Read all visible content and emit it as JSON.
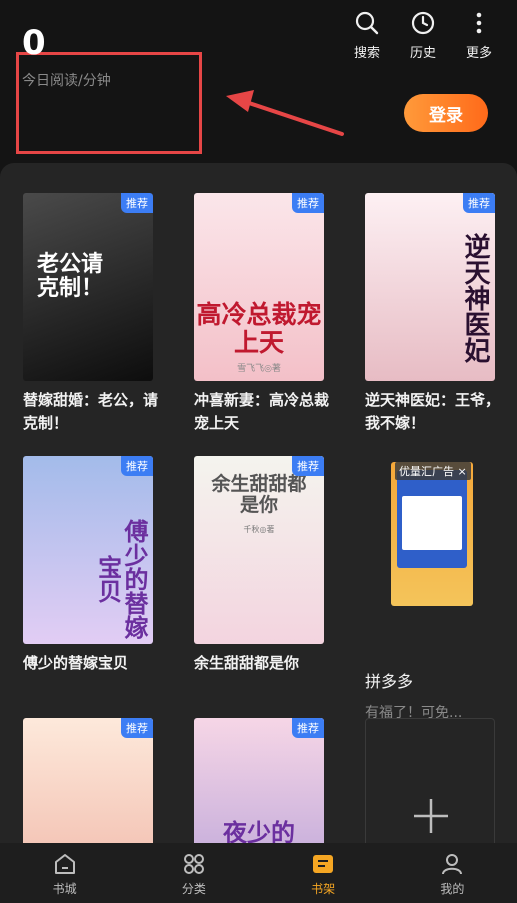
{
  "header": {
    "actions": [
      {
        "label": "搜索",
        "icon": "search-icon"
      },
      {
        "label": "历史",
        "icon": "clock-icon"
      },
      {
        "label": "更多",
        "icon": "more-vertical-icon"
      }
    ],
    "reading": {
      "count": "0",
      "label": "今日阅读/分钟"
    },
    "login_label": "登录"
  },
  "books": [
    {
      "title": "替嫁甜婚：老公，请克制！",
      "tag": "推荐",
      "cover_text": "老公请克制！",
      "colors": [
        "#3b3b3b",
        "#0f0f0f"
      ],
      "text_color": "#ffffff"
    },
    {
      "title": "冲喜新妻：高冷总裁宠上天",
      "tag": "推荐",
      "cover_text": "高冷总裁宠上天",
      "cover_author": "雪飞飞◎著",
      "colors": [
        "#fbe0e4",
        "#f6c6cc"
      ],
      "text_color": "#c0192f"
    },
    {
      "title": "逆天神医妃：王爷，我不嫁！",
      "tag": "推荐",
      "cover_text": "逆天神医妃",
      "colors": [
        "#fbe9ee",
        "#e9c2c9"
      ],
      "text_color": "#3a1a3a"
    },
    {
      "title": "傅少的替嫁宝贝",
      "tag": "推荐",
      "cover_text": "傅少的替嫁宝贝",
      "colors": [
        "#9fb6e6",
        "#d9c4f2"
      ],
      "text_color": "#6b2f9f"
    },
    {
      "title": "余生甜甜都是你",
      "tag": "推荐",
      "cover_text": "余生甜甜都是你",
      "cover_author": "千秋◎著",
      "colors": [
        "#f3f3ec",
        "#f5d9e2"
      ],
      "text_color": "#555555"
    },
    {
      "title": "",
      "tag": "推荐",
      "cover_text": "",
      "colors": [
        "#fde8d8",
        "#f2b8a8"
      ],
      "text_color": "#c0192f"
    },
    {
      "title": "",
      "tag": "推荐",
      "cover_text": "夜少的",
      "colors": [
        "#f6d3e4",
        "#b9a3d9"
      ],
      "text_color": "#6b2f9f"
    }
  ],
  "ad": {
    "label": "优量汇广告 ×",
    "title": "拼多多",
    "subtitle": "有福了！可免..."
  },
  "nav": [
    {
      "label": "书城",
      "icon": "home-icon",
      "active": false
    },
    {
      "label": "分类",
      "icon": "grid-icon",
      "active": false
    },
    {
      "label": "书架",
      "icon": "bookshelf-icon",
      "active": true
    },
    {
      "label": "我的",
      "icon": "user-icon",
      "active": false
    }
  ],
  "colors": {
    "accent": "#f5a623",
    "login_gradient": "#ff7a1a",
    "highlight_border": "#e64646",
    "tag": "#3c7df4"
  }
}
